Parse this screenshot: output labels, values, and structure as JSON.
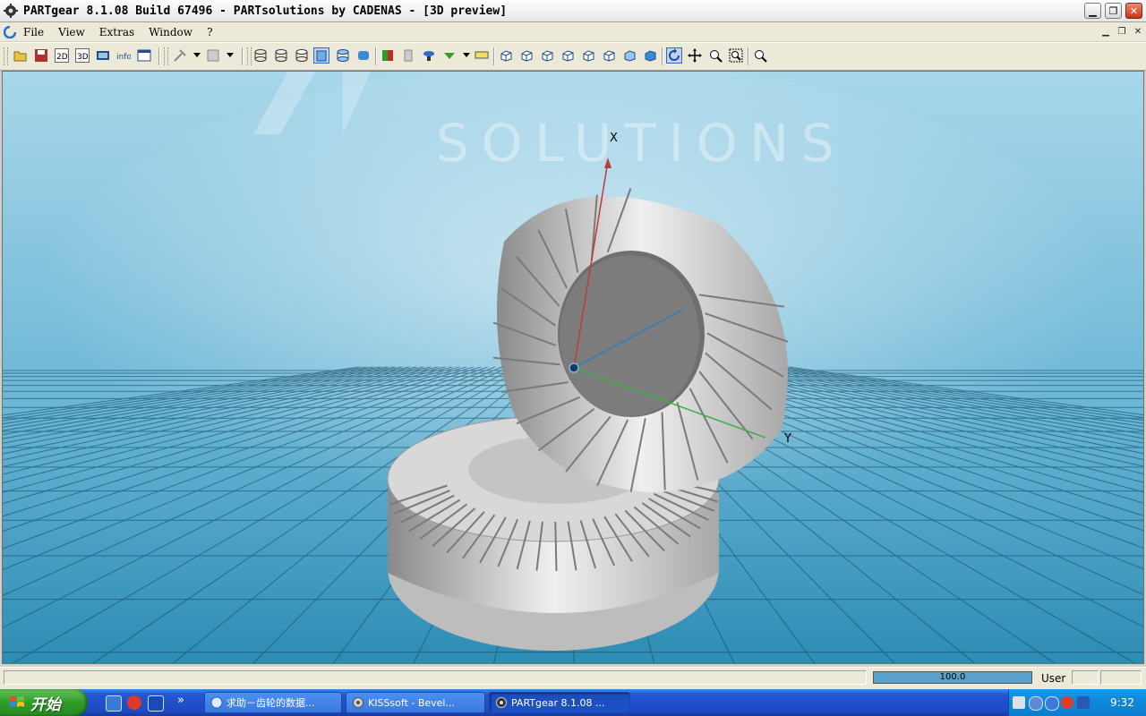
{
  "window": {
    "title": "PARTgear 8.1.08 Build 67496 - PARTsolutions by CADENAS - [3D preview]"
  },
  "menu": {
    "items": [
      {
        "label": "File"
      },
      {
        "label": "View"
      },
      {
        "label": "Extras"
      },
      {
        "label": "Window"
      },
      {
        "label": "?"
      }
    ]
  },
  "viewport": {
    "watermark_word": "SOLUTIONS",
    "axis_x_label": "X",
    "axis_y_label": "Y",
    "axis_colors": {
      "x": "#c0393b",
      "y": "#3cb043",
      "z": "#2a7fc0"
    },
    "background_top": "#a8d6e8",
    "background_floor": "#2f8fb5"
  },
  "status": {
    "progress_text": "100.0",
    "progress_value": 1.0,
    "mode": "User"
  },
  "taskbar": {
    "start_label": "开始",
    "tasks": [
      {
        "label": "求助－齿轮的数据...",
        "active": false
      },
      {
        "label": "KISSsoft - Bevel...",
        "active": false
      },
      {
        "label": "PARTgear 8.1.08 ...",
        "active": true
      }
    ],
    "clock": "9:32"
  },
  "icons": {
    "toolbar": [
      "open-icon",
      "save-icon",
      "2d-icon",
      "3d-icon",
      "film-icon",
      "info-icon",
      "window-icon",
      "tools-icon",
      "grid-tools-icon",
      "view-cylinder-icon",
      "view-cylinder-icon",
      "view-cylinder-icon",
      "view-cylinder-active-icon",
      "view-cylinder-icon",
      "view-cylinder-color-icon",
      "color-icon",
      "material-icon",
      "lamp-icon",
      "arrow-down-icon",
      "measure-icon",
      "iso-view-icon",
      "rotate-icon",
      "pan-icon",
      "zoom-window-icon",
      "zoom-fit-icon",
      "zoom-icon"
    ]
  }
}
